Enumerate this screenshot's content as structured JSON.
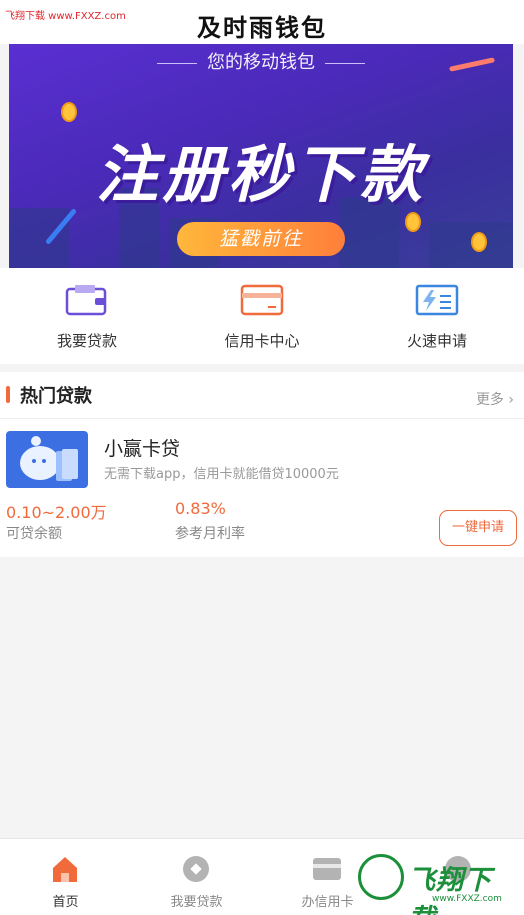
{
  "watermark_top": "飞翔下载 www.FXXZ.com",
  "app_title": "及时雨钱包",
  "banner": {
    "subtitle": "您的移动钱包",
    "headline": "注册秒下款",
    "cta": "猛戳前往",
    "slide_count": 3,
    "active_slide": 1
  },
  "quick_actions": [
    {
      "label": "我要贷款",
      "icon": "wallet-icon",
      "color": "#6b4fd8"
    },
    {
      "label": "信用卡中心",
      "icon": "credit-card-icon",
      "color": "#f06a3c"
    },
    {
      "label": "火速申请",
      "icon": "lightning-form-icon",
      "color": "#3b86e0"
    }
  ],
  "hot_loans": {
    "title": "热门贷款",
    "more": "更多",
    "items": [
      {
        "name": "小赢卡贷",
        "description": "无需下载app，信用卡就能借贷10000元",
        "amount_value": "0.10~2.00万",
        "amount_label": "可贷余额",
        "rate_value": "0.83%",
        "rate_label": "参考月利率",
        "apply_label": "一键申请"
      }
    ]
  },
  "tabbar": {
    "items": [
      {
        "label": "首页",
        "icon": "home-icon",
        "active": true
      },
      {
        "label": "我要贷款",
        "icon": "loan-coin-icon",
        "active": false
      },
      {
        "label": "办信用卡",
        "icon": "card-icon",
        "active": false
      },
      {
        "label": "",
        "icon": "profile-icon",
        "active": false
      }
    ]
  },
  "watermark_bottom": {
    "brand": "飞翔下载",
    "url": "www.FXXZ.com"
  },
  "colors": {
    "accent": "#f06a3c",
    "banner_bg": "#4a2ab8",
    "watermark_green": "#1b8f3a"
  }
}
